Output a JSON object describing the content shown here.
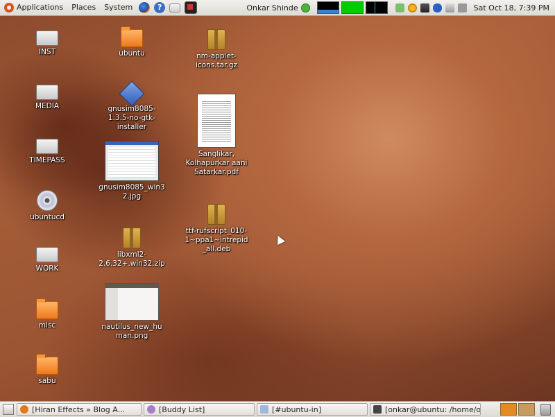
{
  "top_panel": {
    "menus": [
      {
        "label": "Applications"
      },
      {
        "label": "Places"
      },
      {
        "label": "System"
      }
    ],
    "launchers": [
      "firefox-icon",
      "help-icon",
      "mail-icon",
      "terminal-icon"
    ],
    "user_name": "Onkar Shinde",
    "clock": "Sat Oct 18,   7:39 PM"
  },
  "desktop": {
    "icons": [
      {
        "name": "drive-inst",
        "label": "INST",
        "type": "drive"
      },
      {
        "name": "drive-media",
        "label": "MEDIA",
        "type": "drive"
      },
      {
        "name": "drive-timepass",
        "label": "TIMEPASS",
        "type": "drive"
      },
      {
        "name": "cd-ubuntucd",
        "label": "ubuntucd",
        "type": "cd"
      },
      {
        "name": "drive-work",
        "label": "WORK",
        "type": "drive"
      },
      {
        "name": "folder-misc",
        "label": "misc",
        "type": "folder"
      },
      {
        "name": "folder-sabu",
        "label": "sabu",
        "type": "folder"
      },
      {
        "name": "folder-ubuntu",
        "label": "ubuntu",
        "type": "folder"
      },
      {
        "name": "file-gnusim-installer",
        "label": "gnusim8085-1.3.5-no-gtk-installer",
        "type": "package"
      },
      {
        "name": "file-gnusim-jpg",
        "label": "gnusim8085_win32.jpg",
        "type": "image"
      },
      {
        "name": "file-libxml2",
        "label": "libxml2-2.6.32+.win32.zip",
        "type": "archive"
      },
      {
        "name": "file-nautilus-png",
        "label": "nautilus_new_human.png",
        "type": "image"
      },
      {
        "name": "file-nm-applet",
        "label": "nm-applet-icons.tar.gz",
        "type": "archive"
      },
      {
        "name": "file-pdf",
        "label": "Sanglīkar, Kolhapurkar aani Satarkar.pdf",
        "type": "pdf"
      },
      {
        "name": "file-deb",
        "label": "ttf-rufscript_010-1~ppa1~intrepid_all.deb",
        "type": "archive"
      }
    ]
  },
  "bottom_panel": {
    "tasks": [
      {
        "label": "[Hiran Effects » Blog A...",
        "icon": "firefox-icon"
      },
      {
        "label": "[Buddy List]",
        "icon": "pidgin-icon"
      },
      {
        "label": "[#ubuntu-in]",
        "icon": "chat-icon"
      },
      {
        "label": "[onkar@ubuntu: /home/o...",
        "icon": "terminal-icon"
      }
    ]
  }
}
